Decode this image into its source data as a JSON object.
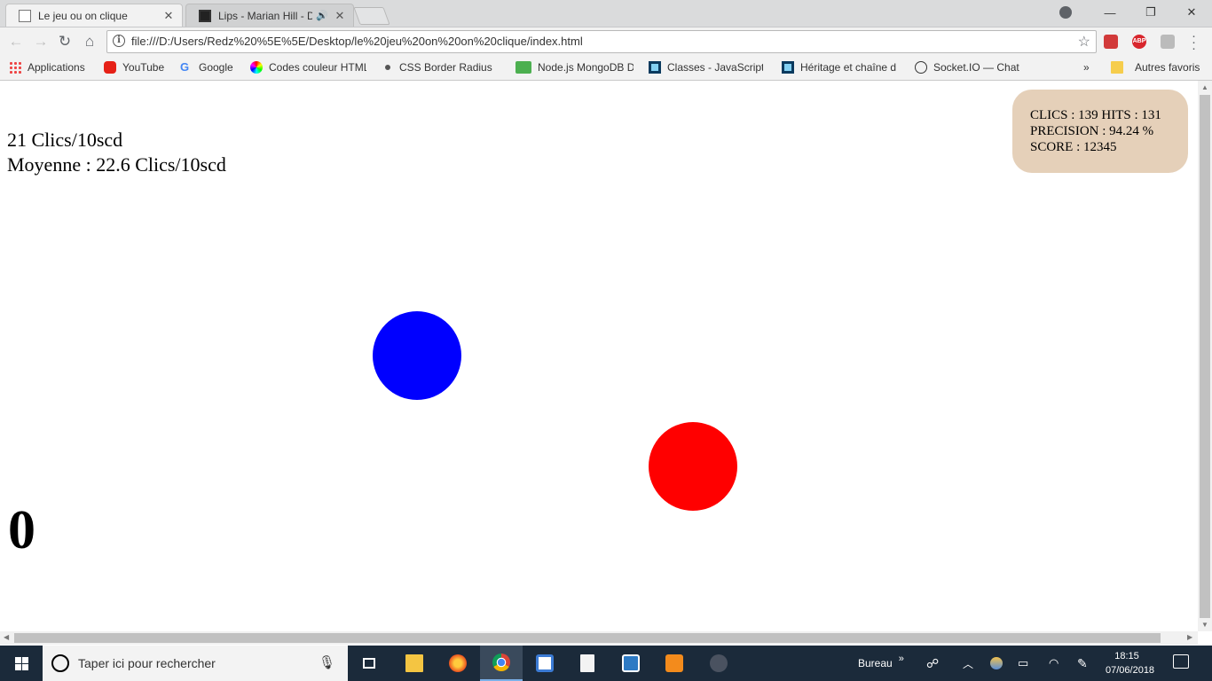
{
  "browser": {
    "tabs": [
      {
        "title": "Le jeu ou on clique",
        "close": "✕"
      },
      {
        "title": "Lips - Marian Hill - De",
        "audio": "🔊",
        "close": "✕"
      }
    ],
    "window_controls": {
      "minimize": "—",
      "restore": "❐",
      "close": "✕"
    },
    "nav": {
      "back": "←",
      "forward": "→",
      "reload": "↻",
      "home": "⌂"
    },
    "url": "file:///D:/Users/Redz%20%5E%5E/Desktop/le%20jeu%20on%20on%20clique/index.html",
    "star": "☆",
    "extensions": {
      "abp_label": "ABP"
    },
    "bookmarks": [
      {
        "label": "Applications",
        "icon": "apps-grid-icon"
      },
      {
        "label": "YouTube",
        "icon": "youtube-icon"
      },
      {
        "label": "Google",
        "icon": "google-icon"
      },
      {
        "label": "Codes couleur HTML",
        "icon": "color-wheel-icon"
      },
      {
        "label": "CSS Border Radius G",
        "icon": "dot-icon"
      },
      {
        "label": "Node.js MongoDB D",
        "icon": "w3-icon"
      },
      {
        "label": "Classes - JavaScript |",
        "icon": "mdn-icon"
      },
      {
        "label": "Héritage et chaîne d",
        "icon": "mdn-icon"
      },
      {
        "label": "Socket.IO — Chat",
        "icon": "socketio-icon"
      }
    ],
    "bookmarks_overflow": "»",
    "other_bookmarks": "Autres favoris"
  },
  "game": {
    "clicks_line": "21 Clics/10scd",
    "average_line": "Moyenne : 22.6 Clics/10scd",
    "stats": {
      "line1": "CLICS : 139 HITS : 131",
      "line2": "PRECISION : 94.24 %",
      "line3": "SCORE : 12345"
    },
    "counter": "0",
    "colors": {
      "blue_target": "#0000ff",
      "red_target": "#ff0000",
      "stats_bg": "#e5d0b9"
    }
  },
  "taskbar": {
    "search_placeholder": "Taper ici pour rechercher",
    "desktop_label": "Bureau",
    "desktop_chevron": "»",
    "time": "18:15",
    "date": "07/06/2018"
  }
}
